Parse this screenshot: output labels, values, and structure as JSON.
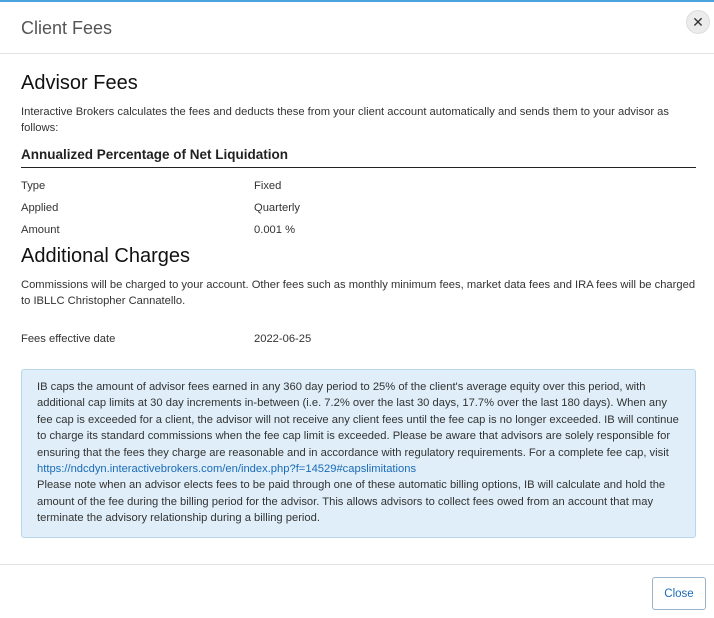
{
  "modal": {
    "title": "Client Fees",
    "close_icon": "close-icon",
    "close_label": "Close"
  },
  "advisor_fees": {
    "heading": "Advisor Fees",
    "intro": "Interactive Brokers calculates the fees and deducts these from your client account automatically and sends them to your advisor as follows:",
    "subheading": "Annualized Percentage of Net Liquidation",
    "rows": [
      {
        "label": "Type",
        "value": "Fixed"
      },
      {
        "label": "Applied",
        "value": "Quarterly"
      },
      {
        "label": "Amount",
        "value": "0.001 %"
      }
    ]
  },
  "additional_charges": {
    "heading": "Additional Charges",
    "text": "Commissions will be charged to your account. Other fees such as monthly minimum fees, market data fees and IRA fees will be charged to IBLLC Christopher Cannatello.",
    "effective_label": "Fees effective date",
    "effective_value": "2022-06-25"
  },
  "notice": {
    "text_before": "IB caps the amount of advisor fees earned in any 360 day period to 25% of the client's average equity over this period, with additional cap limits at 30 day increments in-between (i.e. 7.2% over the last 30 days, 17.7% over the last 180 days). When any fee cap is exceeded for a client, the advisor will not receive any client fees until the fee cap is no longer exceeded. IB will continue to charge its standard commissions when the fee cap limit is exceeded. Please be aware that advisors are solely responsible for ensuring that the fees they charge are reasonable and in accordance with regulatory requirements. For a complete fee cap, visit ",
    "link": "https://ndcdyn.interactivebrokers.com/en/index.php?f=14529#capslimitations",
    "text_after": "Please note when an advisor elects fees to be paid through one of these automatic billing options, IB will calculate and hold the amount of the fee during the billing period for the advisor. This allows advisors to collect fees owed from an account that may terminate the advisory relationship during a billing period."
  }
}
